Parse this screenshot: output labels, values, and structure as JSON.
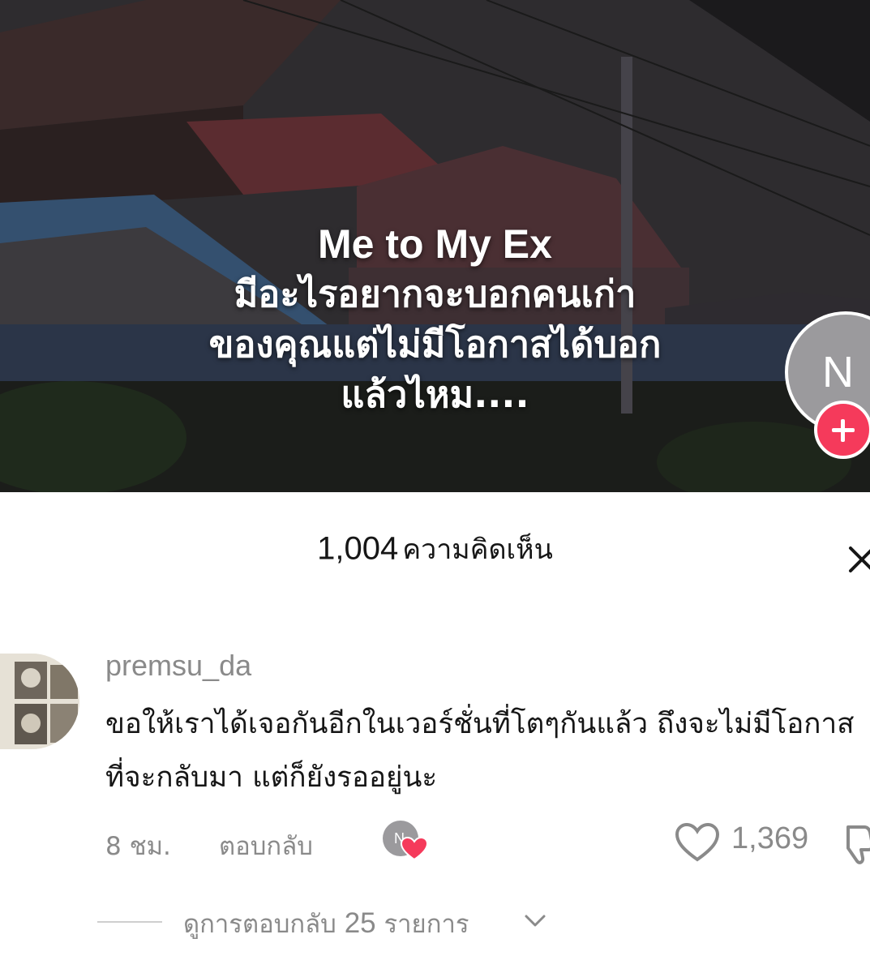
{
  "video": {
    "overlay_title": "Me to My Ex",
    "overlay_lines": [
      "มีอะไรอยากจะบอกคนเก่า",
      "ของคุณแต่ไม่มีโอกาสได้บอก",
      "แล้วไหม...."
    ],
    "creator_initial": "N"
  },
  "comments_header": {
    "count": "1,004",
    "label": "ความคิดเห็น"
  },
  "comment": {
    "username": "premsu_da",
    "text": "ขอให้เราได้เจอกันอีกในเวอร์ชั่นที่โตๆกันแล้ว ถึงจะไม่มีโอกาสที่จะกลับมา แต่ก็ยังรออยู่นะ",
    "time": "8 ชม.",
    "reply_label": "ตอบกลับ",
    "creator_liked_initial": "N",
    "likes": "1,369"
  },
  "replies": {
    "label": "ดูการตอบกลับ",
    "count": "25",
    "unit": "รายการ"
  },
  "colors": {
    "accent": "#f53a5b",
    "text_primary": "#161616",
    "text_secondary": "#8a8a8a"
  },
  "icons": [
    "plus-icon",
    "close-icon",
    "heart-icon",
    "dislike-icon",
    "chevron-down-icon"
  ]
}
